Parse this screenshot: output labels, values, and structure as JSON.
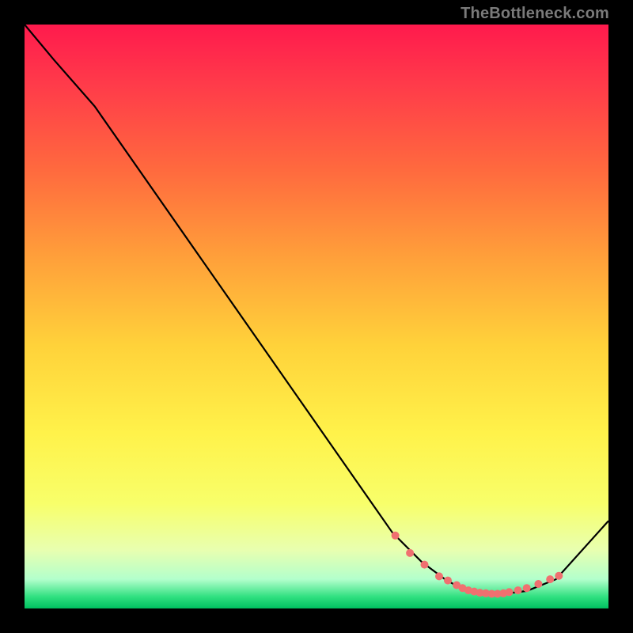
{
  "attribution": "TheBottleneck.com",
  "colors": {
    "curve": "#000000",
    "marker_fill": "#f07070",
    "marker_stroke": "#000000",
    "frame_bg": "#000000"
  },
  "chart_data": {
    "type": "line",
    "title": "",
    "xlabel": "",
    "ylabel": "",
    "xlim": [
      0,
      100
    ],
    "ylim": [
      0,
      100
    ],
    "grid": false,
    "legend": false,
    "series": [
      {
        "name": "curve",
        "x": [
          0,
          5,
          12,
          63,
          68,
          72,
          75,
          78,
          82,
          86,
          91,
          100
        ],
        "y": [
          100,
          94,
          86,
          13,
          8,
          5,
          3.3,
          2.6,
          2.5,
          3,
          5,
          15
        ]
      }
    ],
    "markers": {
      "x": [
        63.5,
        66,
        68.5,
        71,
        72.5,
        74,
        75,
        76,
        77,
        78,
        79,
        80,
        81,
        82,
        83,
        84.5,
        86,
        88,
        90,
        91.5
      ],
      "y": [
        12.5,
        9.5,
        7.5,
        5.5,
        4.8,
        4,
        3.5,
        3.1,
        2.9,
        2.7,
        2.6,
        2.5,
        2.5,
        2.6,
        2.8,
        3.1,
        3.5,
        4.2,
        5,
        5.6
      ]
    }
  }
}
